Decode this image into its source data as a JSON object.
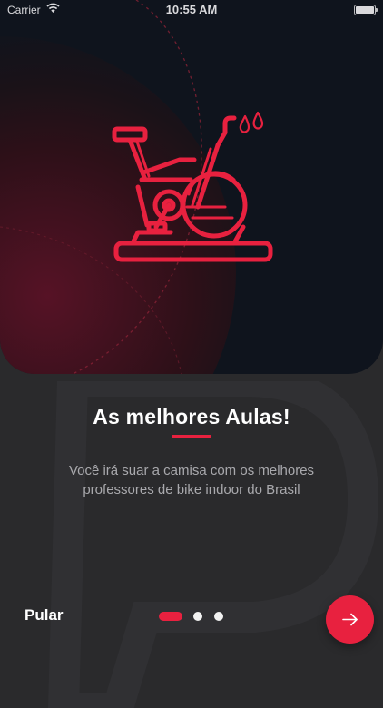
{
  "status_bar": {
    "carrier": "Carrier",
    "time": "10:55 AM",
    "battery_level": 0.9
  },
  "hero": {
    "illustration": "spin-bike-icon",
    "accent_color": "#e8213f",
    "background_color": "#0f141d"
  },
  "onboarding": {
    "title": "As melhores Aulas!",
    "description": "Você irá suar a camisa com os melhores professores de bike indoor do Brasil",
    "skip_label": "Pular",
    "page_count": 3,
    "current_page": 1,
    "next_icon": "arrow-right-icon"
  }
}
